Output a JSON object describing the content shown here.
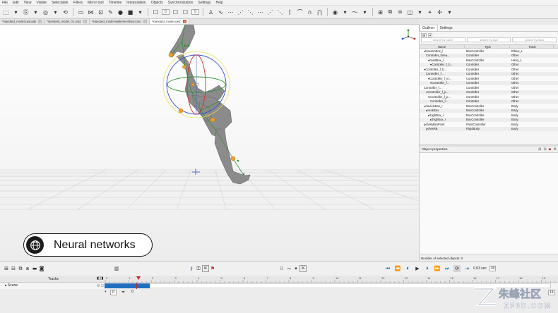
{
  "menu": [
    "File",
    "Edit",
    "View",
    "Visible",
    "Selectable",
    "Filters",
    "Mirror tool",
    "Timeline",
    "Interpolation",
    "Objects",
    "Synchronization",
    "Settings",
    "Help"
  ],
  "toolbar": {
    "field_a": "0",
    "field_b": "0"
  },
  "doc_tabs": [
    {
      "label": "*standard_model.cascade",
      "active": false
    },
    {
      "label": "*standard_model_01.casc",
      "active": false
    },
    {
      "label": "*standard_model-wallerss-elbow.casc",
      "active": false
    },
    {
      "label": "*standard_model.casc",
      "active": true
    }
  ],
  "outliner": {
    "tabs": [
      "Outliner",
      "Settings"
    ],
    "search": [
      "search by name",
      "search by type",
      "search by track"
    ],
    "columns": [
      "Name",
      "Type",
      "Track"
    ],
    "rows": [
      {
        "name": "▾forearmBox_l",
        "type": "BoxController",
        "track": "Elbow_L"
      },
      {
        "name": "Controller_forea...",
        "type": "Controller",
        "track": "Other"
      },
      {
        "name": "▾handBox_l",
        "type": "BoxController",
        "track": "Hand_L"
      },
      {
        "name": "▾Controller_f_b...",
        "type": "Controller",
        "track": "Other"
      },
      {
        "name": "▾Controller_f_b...",
        "type": "Controller",
        "track": "Other"
      },
      {
        "name": "Controller_f...",
        "type": "Controller",
        "track": "Other"
      },
      {
        "name": "▾Controller_f_m...",
        "type": "Controller",
        "track": "Other"
      },
      {
        "name": "▾Controller_f...",
        "type": "Controller",
        "track": "Other"
      },
      {
        "name": "Controller_f...",
        "type": "Controller",
        "track": "Other"
      },
      {
        "name": "▾Controller_f_p...",
        "type": "Controller",
        "track": "Other"
      },
      {
        "name": "▾Controller_f_p...",
        "type": "Controller",
        "track": "Other"
      },
      {
        "name": "Controller_f...",
        "type": "Controller",
        "track": "Other"
      },
      {
        "name": "▸clavicleBox_r",
        "type": "BoxController",
        "track": "Body"
      },
      {
        "name": "▸neckBox",
        "type": "BoxController",
        "track": "Body"
      },
      {
        "name": "▸thighBox_l",
        "type": "BoxController",
        "track": "Body"
      },
      {
        "name": "▸thighBox_r",
        "type": "BoxController",
        "track": "Body"
      },
      {
        "name": "pelvisMainPoint",
        "type": "PointController",
        "track": "Body"
      },
      {
        "name": "pelvisRB",
        "type": "RigidBody",
        "track": "Body"
      }
    ]
  },
  "properties": {
    "title": "Object properties",
    "selection_status": "Number of selected objects: 0"
  },
  "badge": {
    "label": "Neural networks"
  },
  "timeline": {
    "tracks_label": "Tracks",
    "scene_label": "▸ Scene",
    "time": "0.03 sec",
    "fps": "30",
    "frame": "19",
    "start_frame": "0",
    "end_frame": "0",
    "ruler": [
      "0",
      "1",
      "2",
      "3",
      "4",
      "5",
      "6",
      "7",
      "8",
      "9",
      "10",
      "11",
      "12",
      "13",
      "14",
      "15",
      "16",
      "17",
      "18",
      "19"
    ]
  },
  "watermark": {
    "brand": "朱峰社区",
    "url": "ZF3D.COM"
  },
  "colors": {
    "accent_blue": "#1f6fbf",
    "playhead": "#d22222",
    "badge_dark": "#1b1b1b"
  }
}
